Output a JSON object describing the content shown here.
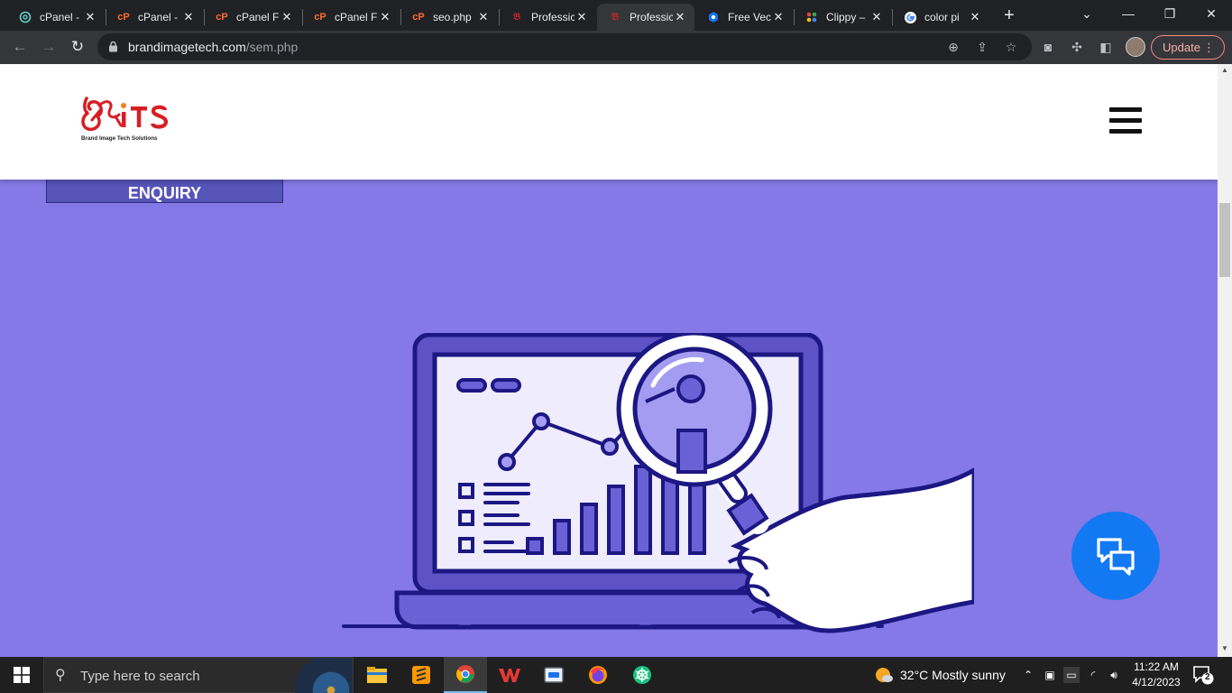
{
  "browser": {
    "tabs": [
      {
        "title": "cPanel -",
        "icon": "cpanel-swirl-icon"
      },
      {
        "title": "cPanel -",
        "icon": "cpanel-logo-icon"
      },
      {
        "title": "cPanel F",
        "icon": "cpanel-logo-icon"
      },
      {
        "title": "cPanel F",
        "icon": "cpanel-logo-icon"
      },
      {
        "title": "seo.php",
        "icon": "cpanel-logo-icon"
      },
      {
        "title": "Professic",
        "icon": "bits-favicon-icon"
      },
      {
        "title": "Professic",
        "icon": "bits-favicon-icon",
        "active": true
      },
      {
        "title": "Free Vec",
        "icon": "freepik-icon"
      },
      {
        "title": "Clippy –",
        "icon": "clippy-icon"
      },
      {
        "title": "color pi",
        "icon": "google-icon"
      }
    ],
    "address": {
      "domain": "brandimagetech.com",
      "path": "/sem.php"
    },
    "update_label": "Update"
  },
  "site": {
    "logo_text": "BITS",
    "logo_tagline": "Brand Image Tech Solutions",
    "enquiry_label": "ENQUIRY",
    "colors": {
      "hero_bg": "#8479e6",
      "button_bg": "#5754b8",
      "chat_fab": "#1279f2",
      "logo_red": "#d81e24"
    }
  },
  "taskbar": {
    "search_placeholder": "Type here to search",
    "weather": "32°C  Mostly sunny",
    "time": "11:22 AM",
    "date": "4/12/2023",
    "notification_count": "2"
  }
}
